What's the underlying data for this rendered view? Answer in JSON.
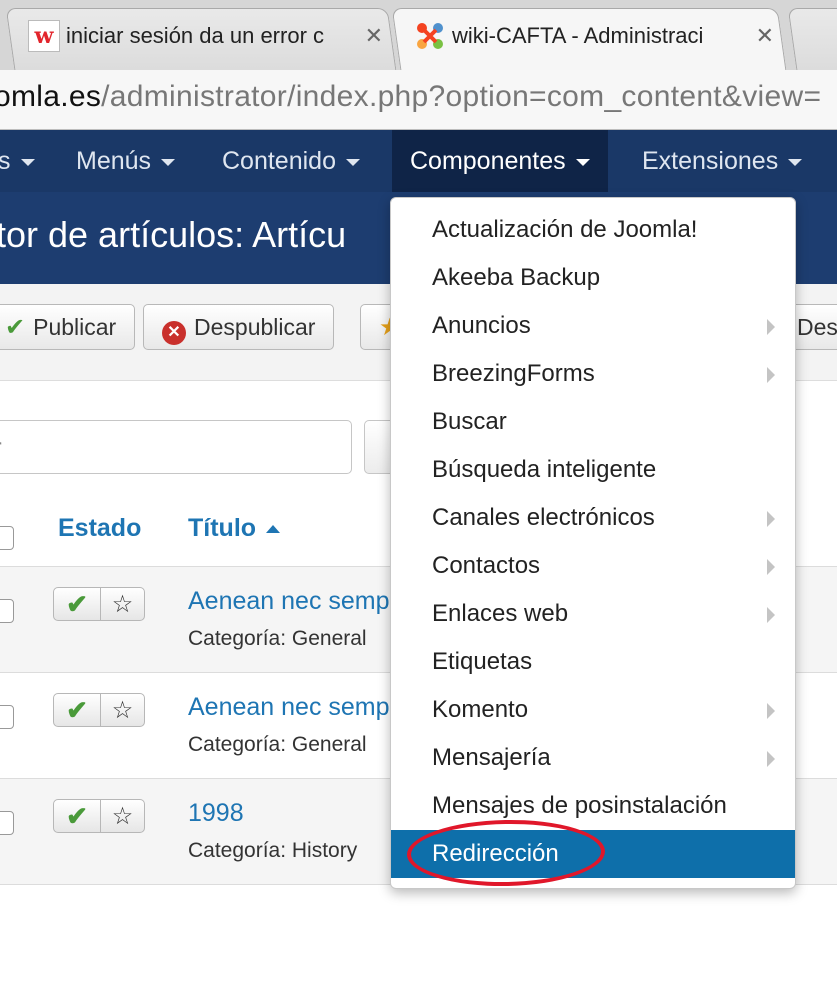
{
  "browser": {
    "tabs": [
      {
        "title": "iniciar sesión da un error c",
        "favicon": "w-icon",
        "active": false
      },
      {
        "title": "wiki-CAFTA - Administraci",
        "favicon": "joomla-icon",
        "active": true
      }
    ],
    "close_glyph": "✕",
    "url_host": "omla.es",
    "url_path": "/administrator/index.php?option=com_content&view="
  },
  "nav": {
    "items": [
      {
        "label": "s"
      },
      {
        "label": "Menús"
      },
      {
        "label": "Contenido"
      },
      {
        "label": "Componentes"
      },
      {
        "label": "Extensiones"
      }
    ]
  },
  "page_title": "tor de artículos: Artícu",
  "toolbar": {
    "publish_label": "Publicar",
    "unpublish_label": "Despublicar",
    "right_label": "Des"
  },
  "filter": {
    "search_value": "r"
  },
  "table": {
    "headers": {
      "status": "Estado",
      "title": "Título"
    },
    "rows": [
      {
        "title": "Aenean nec semp",
        "category": "Categoría: General"
      },
      {
        "title": "Aenean nec semp",
        "category": "Categoría: General"
      },
      {
        "title": "1998",
        "category": "Categoría: History"
      }
    ]
  },
  "dropdown": {
    "items": [
      {
        "label": "Actualización de Joomla!",
        "submenu": false
      },
      {
        "label": "Akeeba Backup",
        "submenu": false
      },
      {
        "label": "Anuncios",
        "submenu": true
      },
      {
        "label": "BreezingForms",
        "submenu": true
      },
      {
        "label": "Buscar",
        "submenu": false
      },
      {
        "label": "Búsqueda inteligente",
        "submenu": false
      },
      {
        "label": "Canales electrónicos",
        "submenu": true
      },
      {
        "label": "Contactos",
        "submenu": true
      },
      {
        "label": "Enlaces web",
        "submenu": true
      },
      {
        "label": "Etiquetas",
        "submenu": false
      },
      {
        "label": "Komento",
        "submenu": true
      },
      {
        "label": "Mensajería",
        "submenu": true
      },
      {
        "label": "Mensajes de posinstalación",
        "submenu": false
      },
      {
        "label": "Redirección",
        "submenu": false,
        "highlighted": true
      }
    ]
  },
  "colors": {
    "nav_bg": "#1a3867",
    "title_bg": "#1d3d70",
    "link_blue": "#1e75b3",
    "highlight": "#0e6faa",
    "annotation_red": "#e0172a"
  }
}
